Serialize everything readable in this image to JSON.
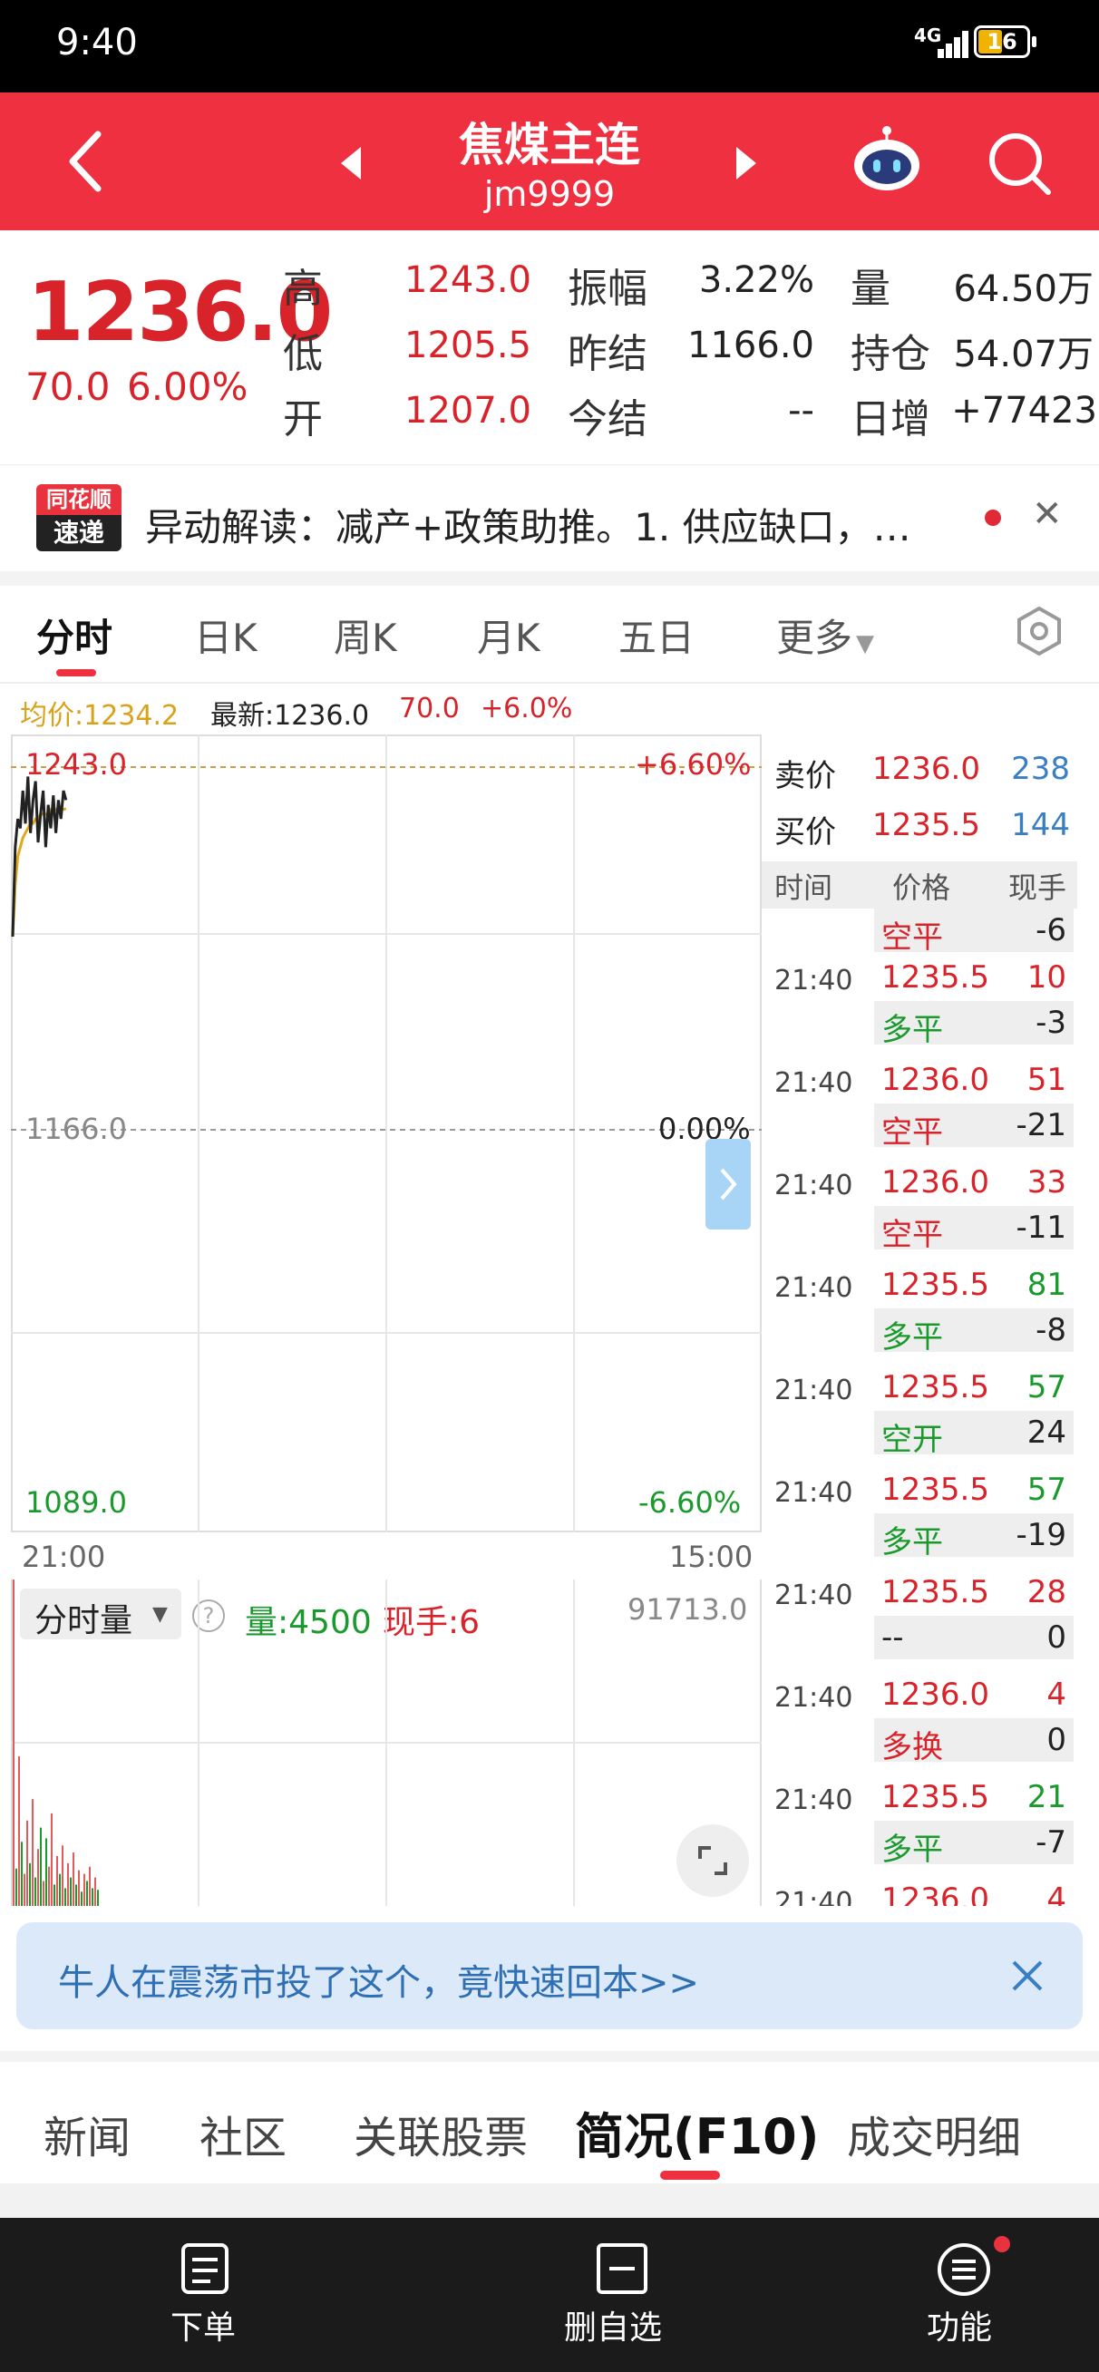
{
  "status_bar": {
    "time": "9:40",
    "network": "4G",
    "battery": "16"
  },
  "header": {
    "title": "焦煤主连",
    "code": "jm9999"
  },
  "quote": {
    "price": "1236.0",
    "change": "70.0",
    "change_pct": "6.00%",
    "stats": [
      {
        "label": "高",
        "value": "1243.0",
        "color": "red"
      },
      {
        "label": "振幅",
        "value": "3.22%",
        "color": "dark"
      },
      {
        "label": "量",
        "value": "64.50万",
        "color": "dark"
      },
      {
        "label": "低",
        "value": "1205.5",
        "color": "red"
      },
      {
        "label": "昨结",
        "value": "1166.0",
        "color": "dark"
      },
      {
        "label": "持仓",
        "value": "54.07万",
        "color": "dark"
      },
      {
        "label": "开",
        "value": "1207.0",
        "color": "red"
      },
      {
        "label": "今结",
        "value": "--",
        "color": "dark"
      },
      {
        "label": "日增",
        "value": "+77423",
        "color": "dark"
      }
    ]
  },
  "news": {
    "logo_line1": "同花顺",
    "logo_line2": "速递",
    "text": "异动解读：减产+政策助推。1. 供应缺口，…"
  },
  "chart_tabs": [
    "分时",
    "日K",
    "周K",
    "月K",
    "五日",
    "更多"
  ],
  "chart_info": {
    "avg_label": "均价:1234.2",
    "latest_label": "最新:1236.0",
    "change": "70.0",
    "change_pct": "+6.0%"
  },
  "chart_axis": {
    "top_price": "1243.0",
    "top_pct": "+6.60%",
    "mid_price": "1166.0",
    "mid_pct": "0.00%",
    "bottom_price": "1089.0",
    "bottom_pct": "-6.60%",
    "start_time": "21:00",
    "end_time": "15:00"
  },
  "chart_data": {
    "type": "line",
    "ylim": [
      1089.0,
      1243.0
    ],
    "reference": 1166.0,
    "series": [
      {
        "values": [
          1207,
          1226,
          1232,
          1230,
          1238,
          1231,
          1241,
          1229,
          1236,
          1240,
          1227,
          1233,
          1238,
          1226,
          1235,
          1230,
          1237,
          1229,
          1236,
          1232,
          1238,
          1236
        ]
      },
      {
        "values": [
          1207,
          1218,
          1224,
          1226,
          1228,
          1229,
          1230,
          1231,
          1231,
          1232,
          1232,
          1233,
          1233,
          1233,
          1233,
          1234,
          1234,
          1234,
          1234,
          1234,
          1234,
          1234.2
        ]
      }
    ],
    "volume_ylim": [
      0,
      91713.0
    ],
    "volume": [
      91713,
      10500,
      42000,
      18000,
      9000,
      24000,
      12000,
      30000,
      8000,
      16000,
      22000,
      7000,
      19000,
      11000,
      26000,
      6000,
      14000,
      9000,
      17000,
      5000,
      12000,
      8000,
      15000,
      6000,
      10000,
      4000,
      9000,
      7000,
      11000,
      5000,
      8000,
      4500
    ],
    "volume_colors": [
      "red",
      "green",
      "red",
      "green",
      "red",
      "red",
      "green",
      "red",
      "green",
      "red",
      "green",
      "red",
      "green",
      "red",
      "red",
      "green",
      "red",
      "green",
      "red",
      "green",
      "red",
      "green",
      "red",
      "green",
      "red",
      "green",
      "red",
      "green",
      "red",
      "green",
      "red",
      "green"
    ]
  },
  "order_book": {
    "sell_label": "卖价",
    "sell_price": "1236.0",
    "sell_qty": "238",
    "buy_label": "买价",
    "buy_price": "1235.5",
    "buy_qty": "144",
    "headers": [
      "时间",
      "价格",
      "现手"
    ]
  },
  "trades_partial_top": {
    "type": "空平",
    "type_color": "red",
    "qty": "-6"
  },
  "trades": [
    {
      "time": "21:40",
      "price": "1235.5",
      "price_color": "red",
      "qty": "10",
      "qty_color": "red",
      "type": "多平",
      "type_color": "green",
      "pos": "-3"
    },
    {
      "time": "21:40",
      "price": "1236.0",
      "price_color": "red",
      "qty": "51",
      "qty_color": "red",
      "type": "空平",
      "type_color": "red",
      "pos": "-21"
    },
    {
      "time": "21:40",
      "price": "1236.0",
      "price_color": "red",
      "qty": "33",
      "qty_color": "red",
      "type": "空平",
      "type_color": "red",
      "pos": "-11"
    },
    {
      "time": "21:40",
      "price": "1235.5",
      "price_color": "red",
      "qty": "81",
      "qty_color": "green",
      "type": "多平",
      "type_color": "green",
      "pos": "-8"
    },
    {
      "time": "21:40",
      "price": "1235.5",
      "price_color": "red",
      "qty": "57",
      "qty_color": "green",
      "type": "空开",
      "type_color": "green",
      "pos": "24"
    },
    {
      "time": "21:40",
      "price": "1235.5",
      "price_color": "red",
      "qty": "57",
      "qty_color": "green",
      "type": "多平",
      "type_color": "green",
      "pos": "-19"
    },
    {
      "time": "21:40",
      "price": "1235.5",
      "price_color": "red",
      "qty": "28",
      "qty_color": "red",
      "type": "--",
      "type_color": "dark",
      "pos": "0"
    },
    {
      "time": "21:40",
      "price": "1236.0",
      "price_color": "red",
      "qty": "4",
      "qty_color": "red",
      "type": "多换",
      "type_color": "red",
      "pos": "0"
    },
    {
      "time": "21:40",
      "price": "1235.5",
      "price_color": "red",
      "qty": "21",
      "qty_color": "green",
      "type": "多平",
      "type_color": "green",
      "pos": "-7"
    }
  ],
  "trades_partial_bottom": {
    "time": "21:40",
    "price": "1236.0",
    "qty": "4"
  },
  "volume": {
    "selector_label": "分时量",
    "vol_label": "量:4500",
    "hand_label": "现手:6",
    "max_label": "91713.0"
  },
  "banner": {
    "text": "牛人在震荡市投了这个，竟快速回本>>"
  },
  "bottom_tabs": [
    "新闻",
    "社区",
    "关联股票",
    "简况(F10)",
    "成交明细"
  ],
  "toolbar": {
    "order": "下单",
    "remove_watch": "删自选",
    "function": "功能"
  },
  "colors": {
    "brand_red": "#ee3040",
    "up_red": "#d8232a",
    "down_green": "#1a9a2c",
    "avg_gold": "#d9a21a",
    "info_blue": "#3a7fc4"
  }
}
